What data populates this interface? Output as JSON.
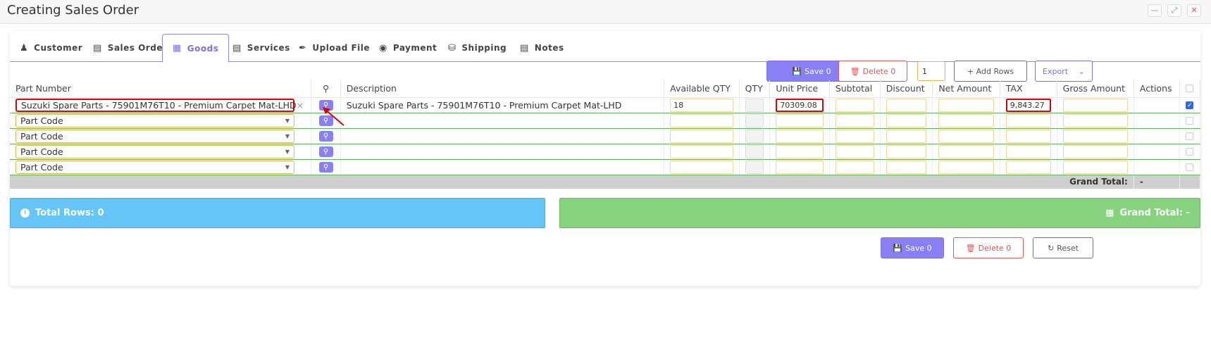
{
  "window": {
    "title": "Creating Sales Order",
    "minimize": "—",
    "maximize": "⤢",
    "close": "✕"
  },
  "tabs": [
    {
      "label": "Customer",
      "icon": "user-icon",
      "glyph": "👤"
    },
    {
      "label": "Sales Order",
      "icon": "document-icon",
      "glyph": "📄"
    },
    {
      "label": "Goods",
      "icon": "boxes-icon",
      "glyph": "📦"
    },
    {
      "label": "Services",
      "icon": "file-icon",
      "glyph": "📄"
    },
    {
      "label": "Upload File",
      "icon": "paperclip-icon",
      "glyph": "📎"
    },
    {
      "label": "Payment",
      "icon": "money-bag-icon",
      "glyph": "💰"
    },
    {
      "label": "Shipping",
      "icon": "truck-icon",
      "glyph": "🚚"
    },
    {
      "label": "Notes",
      "icon": "notebook-icon",
      "glyph": "📓"
    }
  ],
  "toolbar": {
    "save_label": "Save 0",
    "delete_label": "Delete  0",
    "rows_count": "1",
    "add_rows_label": "+ Add Rows",
    "export_label": "Export"
  },
  "table": {
    "headers": {
      "part_number": "Part Number",
      "description": "Description",
      "available_qty": "Available QTY",
      "qty": "QTY",
      "unit_price": "Unit Price",
      "subtotal": "Subtotal",
      "discount": "Discount",
      "net_amount": "Net Amount",
      "tax": "TAX",
      "gross_amount": "Gross Amount",
      "actions": "Actions"
    },
    "first_row": {
      "part": "Suzuki Spare Parts - 75901M76T10 - Premium Carpet Mat-LHD",
      "description": "Suzuki Spare Parts - 75901M76T10 - Premium Carpet Mat-LHD",
      "available_qty": "18",
      "unit_price": "70309.08",
      "tax": "9,843.27"
    },
    "placeholder": "Part Code",
    "grand_total_label": "Grand Total:",
    "grand_total_value": "-"
  },
  "summary": {
    "total_rows": "Total Rows: 0",
    "grand_total": "Grand Total: -"
  },
  "footer": {
    "save_label": "Save 0",
    "delete_label": "Delete  0",
    "reset_label": "Reset"
  },
  "colors": {
    "accent": "#8a80f5",
    "danger": "#e25555",
    "info": "#66c5f7",
    "success": "#86d27e"
  }
}
